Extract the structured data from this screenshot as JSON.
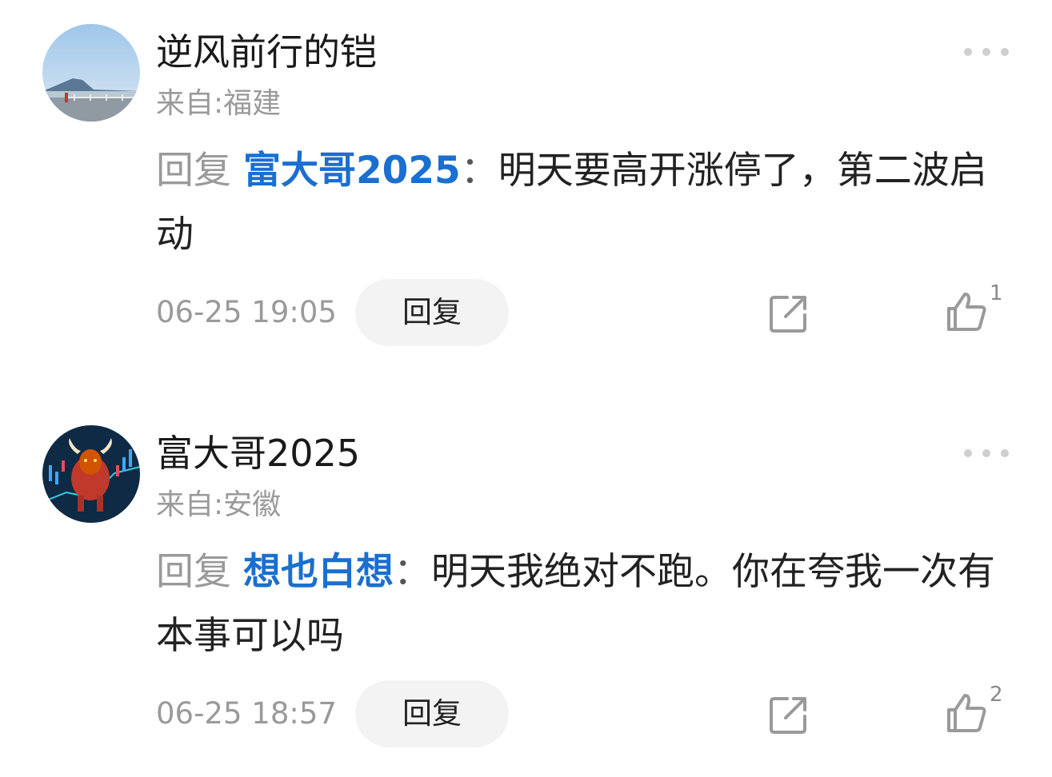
{
  "comments": [
    {
      "username": "逆风前行的铠",
      "location": "来自:福建",
      "reply_word": "回复",
      "mention": "富大哥2025",
      "colon": "：",
      "text": "明天要高开涨停了，第二波启动",
      "time": "06-25 19:05",
      "reply_button": "回复",
      "likes": "1",
      "avatar_icon": "landscape-avatar"
    },
    {
      "username": "富大哥2025",
      "location": "来自:安徽",
      "reply_word": "回复",
      "mention": "想也白想",
      "colon": "：",
      "text": "明天我绝对不跑。你在夸我一次有本事可以吗",
      "time": "06-25 18:57",
      "reply_button": "回复",
      "likes": "2",
      "avatar_icon": "bull-avatar"
    }
  ],
  "colors": {
    "mention": "#1a6fd0",
    "muted": "#9a9a9a",
    "text": "#222222",
    "button_bg": "#f3f3f3"
  }
}
